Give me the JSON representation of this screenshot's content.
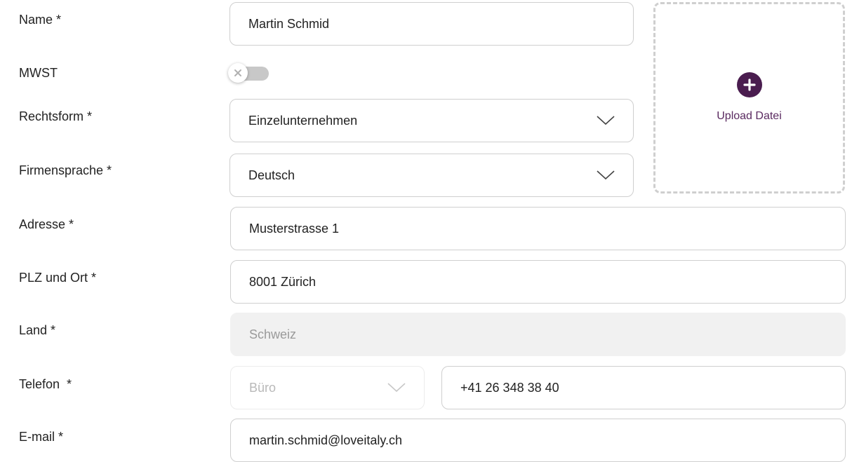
{
  "form": {
    "name": {
      "label": "Name *",
      "value": "Martin Schmid"
    },
    "mwst": {
      "label": "MWST",
      "enabled": false
    },
    "rechtsform": {
      "label": "Rechtsform *",
      "value": "Einzelunternehmen"
    },
    "firmensprache": {
      "label": "Firmensprache *",
      "value": "Deutsch"
    },
    "adresse": {
      "label": "Adresse *",
      "value": "Musterstrasse 1"
    },
    "plz_ort": {
      "label": "PLZ und Ort *",
      "value": "8001 Zürich"
    },
    "land": {
      "label": "Land *",
      "value": "Schweiz"
    },
    "telefon": {
      "label": "Telefon  *",
      "type_placeholder": "Büro",
      "value": "+41 26 348 38 40"
    },
    "email": {
      "label": "E-mail *",
      "value": "martin.schmid@loveitaly.ch"
    }
  },
  "upload": {
    "label": "Upload Datei",
    "icon": "plus-circle-icon"
  },
  "colors": {
    "accent": "#4a1d4f",
    "border": "#cfcfcf",
    "disabled_bg": "#f1f1f1"
  }
}
